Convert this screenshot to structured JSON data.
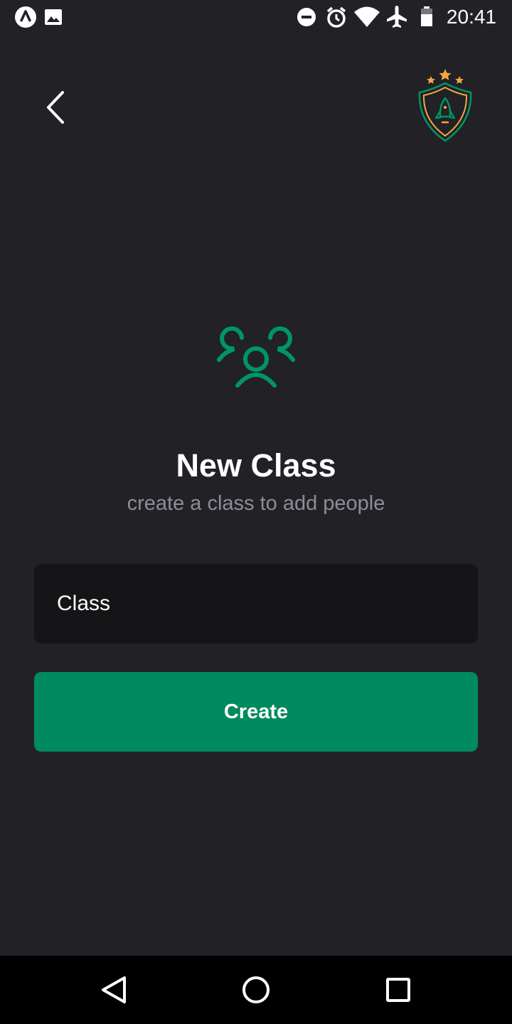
{
  "status_bar": {
    "time": "20:41",
    "left_icons": [
      "app-notification-icon",
      "image-notification-icon"
    ],
    "right_icons": [
      "do-not-disturb-icon",
      "alarm-icon",
      "wifi-icon",
      "airplane-mode-icon",
      "battery-icon"
    ]
  },
  "header": {
    "back_icon": "chevron-left-icon",
    "logo_icon": "rocket-shield-logo"
  },
  "main": {
    "icon": "people-group-icon",
    "title": "New Class",
    "subtitle": "create a class to add people",
    "class_input": {
      "placeholder": "Class",
      "value": ""
    },
    "create_label": "Create"
  },
  "nav_bar": {
    "icons": [
      "nav-back-icon",
      "nav-home-icon",
      "nav-recents-icon"
    ]
  },
  "colors": {
    "background": "#212126",
    "input_background": "#151518",
    "accent_green": "#008a5e",
    "icon_green": "#009566",
    "logo_orange": "#f3a640",
    "subtitle_gray": "#8d8d97",
    "nav_background": "#000000"
  }
}
